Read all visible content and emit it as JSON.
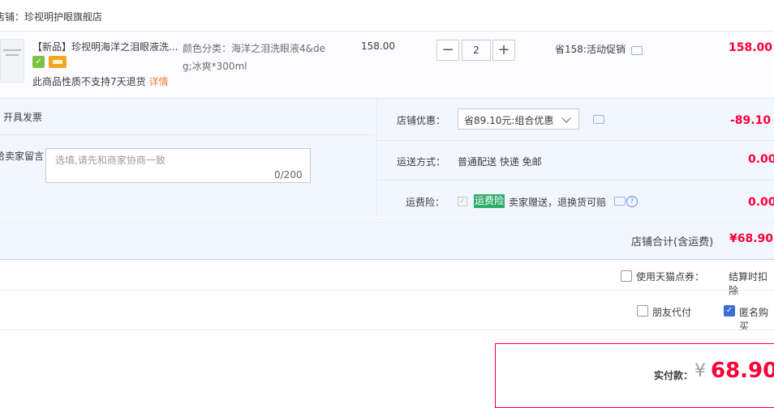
{
  "shop": {
    "label": "店铺：珍视明护眼旗舰店"
  },
  "item": {
    "title": "【新品】珍视明海洋之泪眼液洗...",
    "badge1_icon": "certified-icon",
    "badge2_icon": "card-icon",
    "sku": "颜色分类：海洋之泪洗眼液4&deg;冰爽*300ml",
    "no_return": "此商品性质不支持7天退货",
    "detail_link": "详情",
    "price": "158.00",
    "quantity": "2",
    "minus": "−",
    "plus": "+",
    "promo": "省158:活动促销",
    "total": "158.00"
  },
  "invoice": {
    "label": "开具发票"
  },
  "message": {
    "label": "给卖家留言：",
    "placeholder": "选填,请先和商家协商一致",
    "count": "0/200"
  },
  "discount": {
    "label": "店铺优惠：",
    "selected": "省89.10元:组合优惠",
    "value": "-89.10"
  },
  "shipping": {
    "label": "运送方式：",
    "text": "普通配送 快递 免邮",
    "value": "0.00"
  },
  "insurance": {
    "label": "运费险：",
    "tag": "运费险",
    "text": "卖家赠送，退换货可赔",
    "help": "?",
    "value": "0.00"
  },
  "summary": {
    "label": "店铺合计(含运费)",
    "value": "¥68.90"
  },
  "points": {
    "label": "使用天猫点券：",
    "right_text": "结算时扣除"
  },
  "options": {
    "friend_pay": "朋友代付",
    "anonymous": "匿名购买",
    "anonymous_checked": true
  },
  "payment": {
    "label": "实付款：",
    "currency": "¥",
    "value": "68.90"
  },
  "colors": {
    "accent_red": "#ff0036",
    "section_bg": "#f2f7ff",
    "link_orange": "#f5803e",
    "check_blue": "#3b6fd6"
  }
}
